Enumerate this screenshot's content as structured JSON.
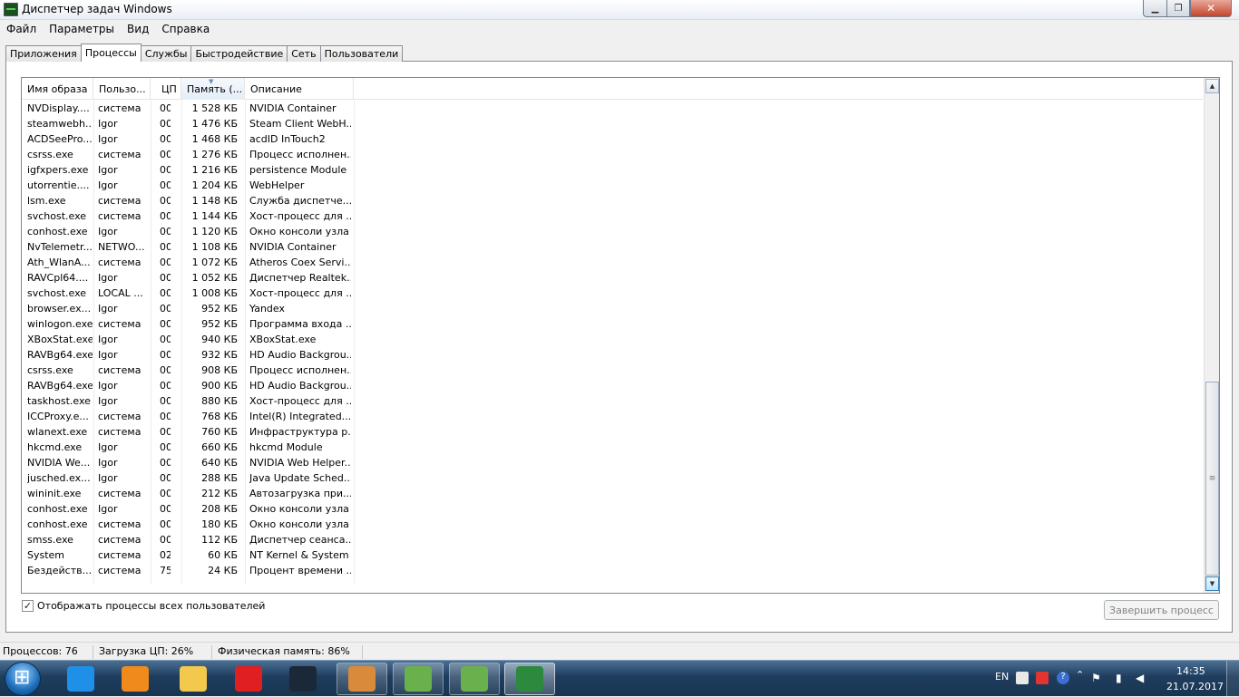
{
  "window": {
    "title": "Диспетчер задач Windows"
  },
  "menu": [
    "Файл",
    "Параметры",
    "Вид",
    "Справка"
  ],
  "tabs": [
    {
      "label": "Приложения",
      "active": false
    },
    {
      "label": "Процессы",
      "active": true
    },
    {
      "label": "Службы",
      "active": false
    },
    {
      "label": "Быстродействие",
      "active": false
    },
    {
      "label": "Сеть",
      "active": false
    },
    {
      "label": "Пользователи",
      "active": false
    }
  ],
  "columns": {
    "name": "Имя образа",
    "user": "Пользо...",
    "cpu": "ЦП",
    "memory": "Память (...",
    "description": "Описание"
  },
  "processes": [
    {
      "name": "NVDisplay....",
      "user": "система",
      "cpu": "00",
      "mem": "1 528 КБ",
      "desc": "NVIDIA Container"
    },
    {
      "name": "steamwebh...",
      "user": "Igor",
      "cpu": "00",
      "mem": "1 476 КБ",
      "desc": "Steam Client WebH..."
    },
    {
      "name": "ACDSeePro...",
      "user": "Igor",
      "cpu": "00",
      "mem": "1 468 КБ",
      "desc": "acdID InTouch2"
    },
    {
      "name": "csrss.exe",
      "user": "система",
      "cpu": "00",
      "mem": "1 276 КБ",
      "desc": "Процесс исполнен..."
    },
    {
      "name": "igfxpers.exe",
      "user": "Igor",
      "cpu": "00",
      "mem": "1 216 КБ",
      "desc": "persistence Module"
    },
    {
      "name": "utorrentie....",
      "user": "Igor",
      "cpu": "00",
      "mem": "1 204 КБ",
      "desc": "WebHelper"
    },
    {
      "name": "lsm.exe",
      "user": "система",
      "cpu": "00",
      "mem": "1 148 КБ",
      "desc": "Служба диспетче..."
    },
    {
      "name": "svchost.exe",
      "user": "система",
      "cpu": "00",
      "mem": "1 144 КБ",
      "desc": "Хост-процесс для ..."
    },
    {
      "name": "conhost.exe",
      "user": "Igor",
      "cpu": "00",
      "mem": "1 120 КБ",
      "desc": "Окно консоли узла"
    },
    {
      "name": "NvTelemetr...",
      "user": "NETWO...",
      "cpu": "00",
      "mem": "1 108 КБ",
      "desc": "NVIDIA Container"
    },
    {
      "name": "Ath_WlanA...",
      "user": "система",
      "cpu": "00",
      "mem": "1 072 КБ",
      "desc": "Atheros Coex Servi..."
    },
    {
      "name": "RAVCpl64....",
      "user": "Igor",
      "cpu": "00",
      "mem": "1 052 КБ",
      "desc": "Диспетчер Realtek..."
    },
    {
      "name": "svchost.exe",
      "user": "LOCAL ...",
      "cpu": "00",
      "mem": "1 008 КБ",
      "desc": "Хост-процесс для ..."
    },
    {
      "name": "browser.ex...",
      "user": "Igor",
      "cpu": "00",
      "mem": "952 КБ",
      "desc": "Yandex"
    },
    {
      "name": "winlogon.exe",
      "user": "система",
      "cpu": "00",
      "mem": "952 КБ",
      "desc": "Программа входа ..."
    },
    {
      "name": "XBoxStat.exe",
      "user": "Igor",
      "cpu": "00",
      "mem": "940 КБ",
      "desc": "XBoxStat.exe"
    },
    {
      "name": "RAVBg64.exe",
      "user": "Igor",
      "cpu": "00",
      "mem": "932 КБ",
      "desc": "HD Audio Backgrou..."
    },
    {
      "name": "csrss.exe",
      "user": "система",
      "cpu": "00",
      "mem": "908 КБ",
      "desc": "Процесс исполнен..."
    },
    {
      "name": "RAVBg64.exe",
      "user": "Igor",
      "cpu": "00",
      "mem": "900 КБ",
      "desc": "HD Audio Backgrou..."
    },
    {
      "name": "taskhost.exe",
      "user": "Igor",
      "cpu": "00",
      "mem": "880 КБ",
      "desc": "Хост-процесс для ..."
    },
    {
      "name": "ICCProxy.e...",
      "user": "система",
      "cpu": "00",
      "mem": "768 КБ",
      "desc": "Intel(R) Integrated..."
    },
    {
      "name": "wlanext.exe",
      "user": "система",
      "cpu": "00",
      "mem": "760 КБ",
      "desc": "Инфраструктура р..."
    },
    {
      "name": "hkcmd.exe",
      "user": "Igor",
      "cpu": "00",
      "mem": "660 КБ",
      "desc": "hkcmd Module"
    },
    {
      "name": "NVIDIA We...",
      "user": "Igor",
      "cpu": "00",
      "mem": "640 КБ",
      "desc": "NVIDIA Web Helper..."
    },
    {
      "name": "jusched.ex...",
      "user": "Igor",
      "cpu": "00",
      "mem": "288 КБ",
      "desc": "Java Update Sched..."
    },
    {
      "name": "wininit.exe",
      "user": "система",
      "cpu": "00",
      "mem": "212 КБ",
      "desc": "Автозагрузка при..."
    },
    {
      "name": "conhost.exe",
      "user": "Igor",
      "cpu": "00",
      "mem": "208 КБ",
      "desc": "Окно консоли узла"
    },
    {
      "name": "conhost.exe",
      "user": "система",
      "cpu": "00",
      "mem": "180 КБ",
      "desc": "Окно консоли узла"
    },
    {
      "name": "smss.exe",
      "user": "система",
      "cpu": "00",
      "mem": "112 КБ",
      "desc": "Диспетчер сеанса..."
    },
    {
      "name": "System",
      "user": "система",
      "cpu": "02",
      "mem": "60 КБ",
      "desc": "NT Kernel & System"
    },
    {
      "name": "Бездейств...",
      "user": "система",
      "cpu": "75",
      "mem": "24 КБ",
      "desc": "Процент времени ..."
    }
  ],
  "show_all_users": {
    "label": "Отображать процессы всех пользователей",
    "checked": true
  },
  "end_process_button": "Завершить процесс",
  "status": {
    "processes": "Процессов: 76",
    "cpu": "Загрузка ЦП: 26%",
    "memory": "Физическая память: 86%"
  },
  "taskbar": {
    "items": [
      {
        "icon": "ie-icon",
        "color": "#1e90e8"
      },
      {
        "icon": "media-player-icon",
        "color": "#f08a1c"
      },
      {
        "icon": "explorer-folder-icon",
        "color": "#f2c94c"
      },
      {
        "icon": "yandex-browser-icon",
        "color": "#e02020"
      },
      {
        "icon": "steam-icon",
        "color": "#1b2838"
      },
      {
        "icon": "download-app-icon",
        "color": "#d98a3a"
      },
      {
        "icon": "gm-app-icon",
        "color": "#6ab04c"
      },
      {
        "icon": "gm-app-icon-2",
        "color": "#6ab04c"
      },
      {
        "icon": "task-manager-icon",
        "color": "#2b8a3e"
      }
    ],
    "tray": {
      "language": "EN",
      "time": "14:35",
      "date": "21.07.2017"
    }
  }
}
